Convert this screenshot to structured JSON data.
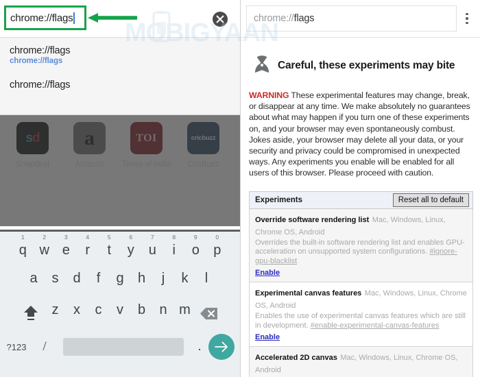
{
  "left": {
    "omnibox": {
      "value": "chrome://flags",
      "clear_icon": "close-circle-icon",
      "highlight_color": "#14a34a"
    },
    "arrow_annotation": {
      "icon": "left-arrow-annotation",
      "color": "#14a34a"
    },
    "suggestions": [
      {
        "primary": "chrome://flags",
        "secondary": "chrome://flags"
      },
      {
        "primary": "chrome://flags",
        "secondary": ""
      }
    ],
    "apps": [
      {
        "label": "Snapdeal",
        "icon": "snapdeal-app-icon",
        "glyph_a": "s",
        "glyph_b": "d",
        "color": "#101314"
      },
      {
        "label": "Amazon",
        "icon": "amazon-app-icon",
        "glyph": "a",
        "color": "#6b6b6b"
      },
      {
        "label": "Times of India",
        "icon": "times-of-india-app-icon",
        "glyph": "TOI",
        "color": "#7d1a20"
      },
      {
        "label": "CricBuzz",
        "icon": "cricbuzz-app-icon",
        "glyph": "cricbuzz",
        "color": "#29465f"
      }
    ],
    "keyboard": {
      "row1": [
        {
          "num": "1",
          "letter": "q"
        },
        {
          "num": "2",
          "letter": "w"
        },
        {
          "num": "3",
          "letter": "e"
        },
        {
          "num": "4",
          "letter": "r"
        },
        {
          "num": "5",
          "letter": "t"
        },
        {
          "num": "6",
          "letter": "y"
        },
        {
          "num": "7",
          "letter": "u"
        },
        {
          "num": "8",
          "letter": "i"
        },
        {
          "num": "9",
          "letter": "o"
        },
        {
          "num": "0",
          "letter": "p"
        }
      ],
      "row2": [
        "a",
        "s",
        "d",
        "f",
        "g",
        "h",
        "j",
        "k",
        "l"
      ],
      "row3": [
        "z",
        "x",
        "c",
        "v",
        "b",
        "n",
        "m"
      ],
      "shift_icon": "shift-up-arrow-icon",
      "backspace_icon": "backspace-delete-icon",
      "symbols_label": "?123",
      "slash_label": "/",
      "period_label": ".",
      "space_label": "",
      "enter_icon": "go-arrow-icon",
      "enter_color": "#3fa8a0"
    }
  },
  "right": {
    "omnibox": {
      "scheme": "chrome://",
      "host": "flags",
      "menu_icon": "three-dot-menu-icon"
    },
    "page": {
      "radiation_icon": "radiation-hazard-icon",
      "title": "Careful, these experiments may bite",
      "warning_label": "WARNING",
      "warning_text": " These experimental features may change, break, or disappear at any time. We make absolutely no guarantees about what may happen if you turn one of these experiments on, and your browser may even spontaneously combust. Jokes aside, your browser may delete all your data, or your security and privacy could be compromised in unexpected ways. Any experiments you enable will be enabled for all users of this browser. Please proceed with caution.",
      "warning_color": "#cc2a26"
    },
    "experiments_bar": {
      "title": "Experiments",
      "reset_button": "Reset all to default"
    },
    "experiments": [
      {
        "name": "Override software rendering list",
        "platforms": "Mac, Windows, Linux, Chrome OS, Android",
        "description": "Overrides the built-in software rendering list and enables GPU-acceleration on unsupported system configurations. ",
        "hash": "#ignore-gpu-blacklist",
        "action": "Enable"
      },
      {
        "name": "Experimental canvas features",
        "platforms": "Mac, Windows, Linux, Chrome OS, Android",
        "description": "Enables the use of experimental canvas features which are still in development. ",
        "hash": "#enable-experimental-canvas-features",
        "action": "Enable"
      },
      {
        "name": "Accelerated 2D canvas",
        "platforms": "Mac, Windows, Linux, Chrome OS, Android",
        "description": "",
        "hash": "",
        "action": ""
      }
    ]
  },
  "watermark": {
    "text": "MOBIGYAAN",
    "icon": "mobile-phone-icon",
    "color": "#b9d4e8"
  }
}
